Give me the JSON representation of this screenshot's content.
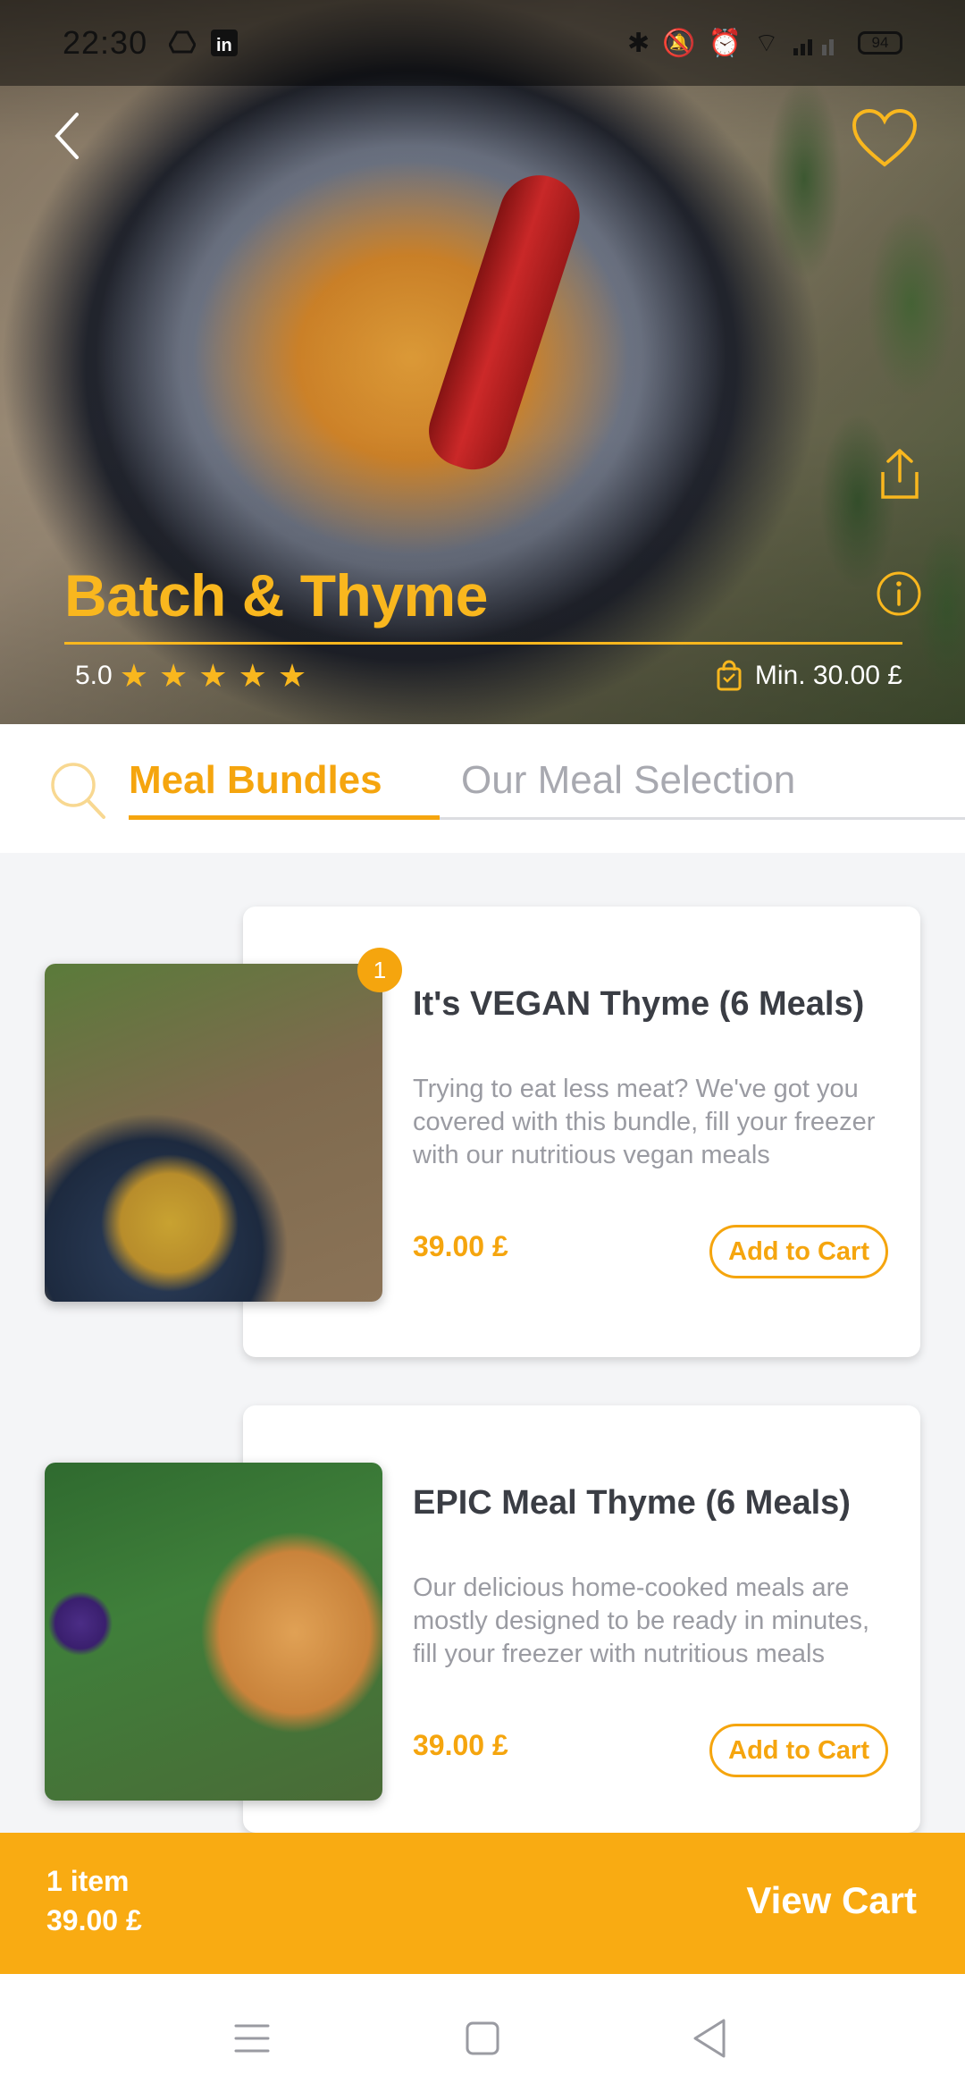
{
  "status_bar": {
    "time": "22:30",
    "battery": "94"
  },
  "hero": {
    "restaurant_name": "Batch & Thyme",
    "rating": "5.0",
    "star_count": 5,
    "min_order": "Min. 30.00 £"
  },
  "tabs": [
    {
      "label": "Meal Bundles",
      "active": true
    },
    {
      "label": "Our Meal Selection",
      "active": false
    }
  ],
  "products": [
    {
      "title": "It's VEGAN Thyme (6 Meals)",
      "description": "Trying to eat less meat? We've got you covered with this bundle, fill your freezer with our nutritious vegan meals",
      "price": "39.00 £",
      "button": "Add to Cart",
      "badge": "1"
    },
    {
      "title": "EPIC Meal Thyme (6 Meals)",
      "description": "Our delicious home-cooked meals are mostly designed to be ready in minutes, fill your freezer with nutritious meals",
      "price": "39.00 £",
      "button": "Add to Cart"
    }
  ],
  "cart": {
    "count": "1 item",
    "total": "39.00 £",
    "action": "View Cart"
  },
  "colors": {
    "accent": "#f5a50e",
    "cart_bar": "#f9ab12",
    "title_text": "#3a3d44",
    "muted_text": "#9a9ba2"
  },
  "icons": {
    "back": "chevron-left-icon",
    "favorite": "heart-icon",
    "share": "share-icon",
    "info": "info-icon",
    "search": "search-icon",
    "min_order": "shopping-bag-icon"
  }
}
